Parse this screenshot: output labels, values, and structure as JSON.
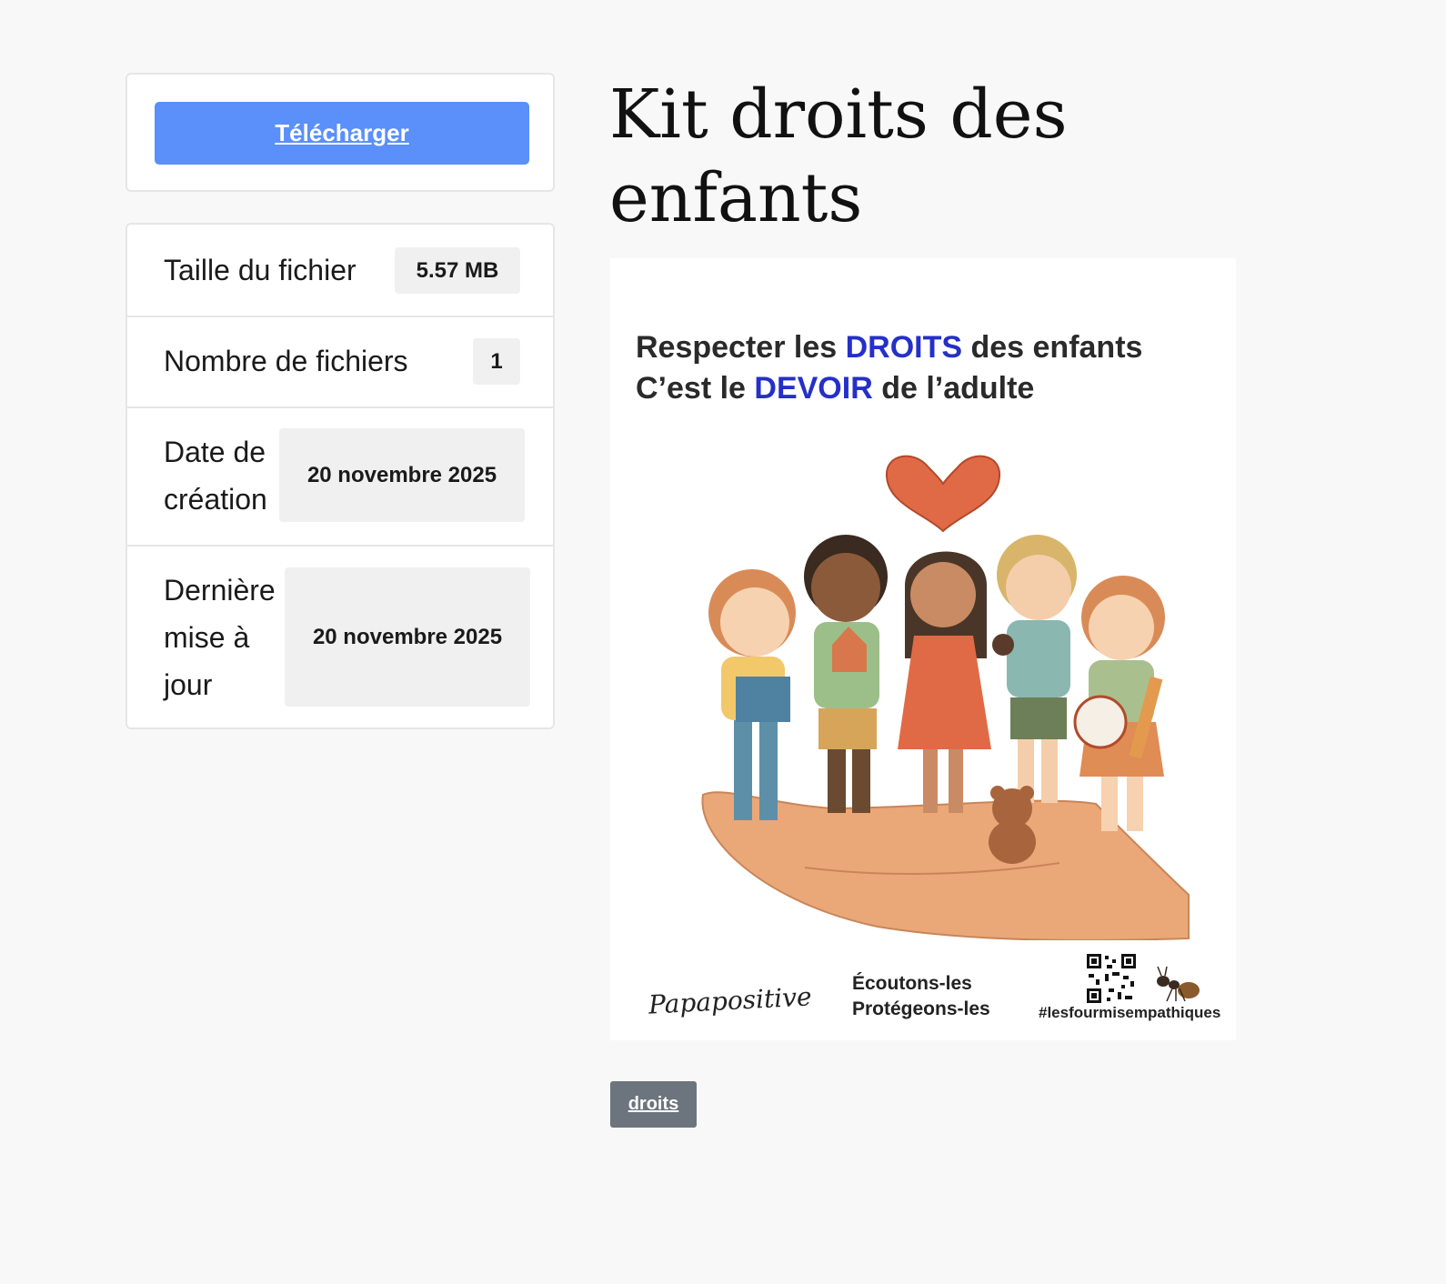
{
  "sidebar": {
    "download_label": "Télécharger",
    "info": [
      {
        "label": "Taille du fichier",
        "value": "5.57 MB"
      },
      {
        "label": "Nombre de fichiers",
        "value": "1"
      },
      {
        "label": "Date de création",
        "value": "20 novembre 2025"
      },
      {
        "label": "Dernière mise à jour",
        "value": "20 novembre 2025"
      }
    ]
  },
  "main": {
    "title": "Kit droits des enfants",
    "poster": {
      "line1_pre": "Respecter les ",
      "line1_hl": "DROITS",
      "line1_post": " des enfants",
      "line2_pre": "C’est le ",
      "line2_hl": "DEVOIR",
      "line2_post": " de l’adulte",
      "brand": "Papapositive",
      "slogan_1": "Écoutons-les",
      "slogan_2": "Protégeons-les",
      "hashtag": "#lesfourmisempathiques",
      "highlight_color": "#2530c8"
    },
    "tags": [
      "droits"
    ]
  },
  "colors": {
    "accent": "#5b8ff9",
    "tag_bg": "#6c757d",
    "page_bg": "#f8f8f8"
  }
}
